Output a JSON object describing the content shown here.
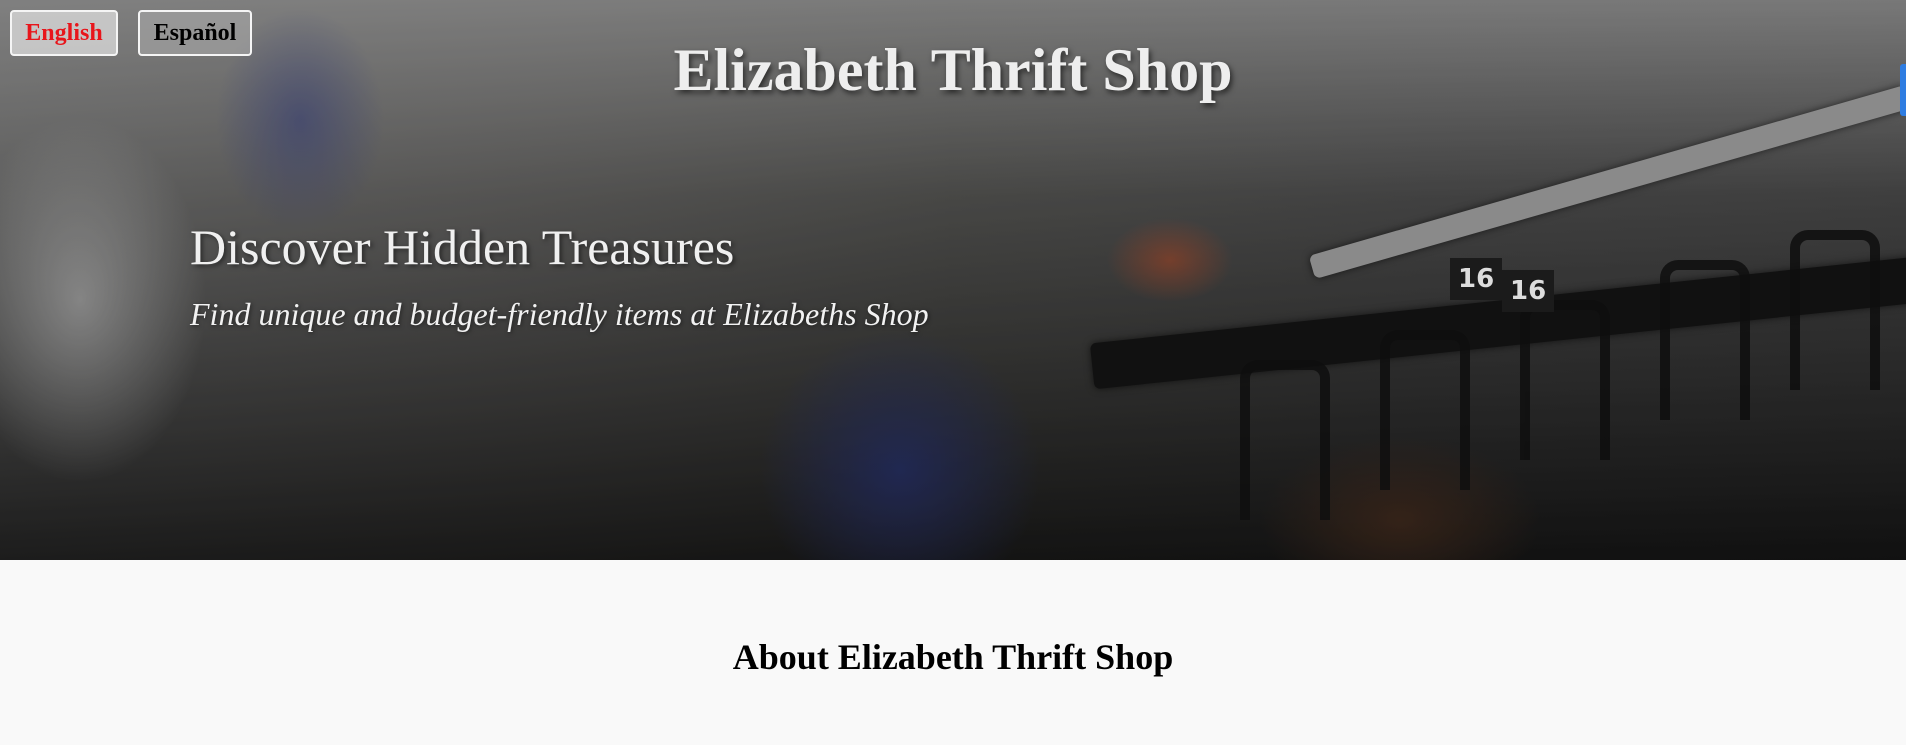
{
  "language_switch": {
    "english_label": "English",
    "spanish_label": "Español",
    "active_color": "#e8151b"
  },
  "header": {
    "title": "Elizabeth Thrift Shop"
  },
  "hero": {
    "heading": "Discover Hidden Treasures",
    "subheading": "Find unique and budget-friendly items at Elizabeths Shop",
    "background": "blurred-clothing-rack-photo",
    "size_tags": [
      "16",
      "16"
    ]
  },
  "about": {
    "heading": "About Elizabeth Thrift Shop"
  }
}
